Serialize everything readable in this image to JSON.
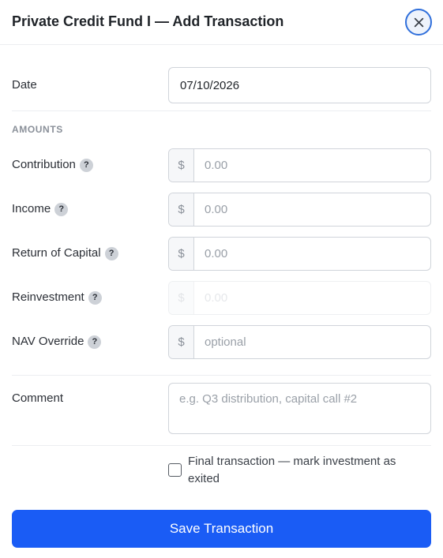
{
  "modal": {
    "title": "Private Credit Fund I — Add Transaction",
    "accent_color": "#1a5cf5"
  },
  "date": {
    "label": "Date",
    "value": "07/10/2026"
  },
  "amounts": {
    "section_label": "AMOUNTS",
    "currency_symbol": "$",
    "help_glyph": "?",
    "contribution": {
      "label": "Contribution",
      "placeholder": "0.00"
    },
    "income": {
      "label": "Income",
      "placeholder": "0.00"
    },
    "return_of_capital": {
      "label": "Return of Capital",
      "placeholder": "0.00"
    },
    "reinvestment": {
      "label": "Reinvestment",
      "placeholder": "0.00",
      "disabled": true
    },
    "nav_override": {
      "label": "NAV Override",
      "placeholder": "optional"
    }
  },
  "comment": {
    "label": "Comment",
    "placeholder": "e.g. Q3 distribution, capital call #2"
  },
  "final_transaction": {
    "label": "Final transaction — mark investment as exited",
    "checked": false
  },
  "save_button": {
    "label": "Save Transaction"
  }
}
